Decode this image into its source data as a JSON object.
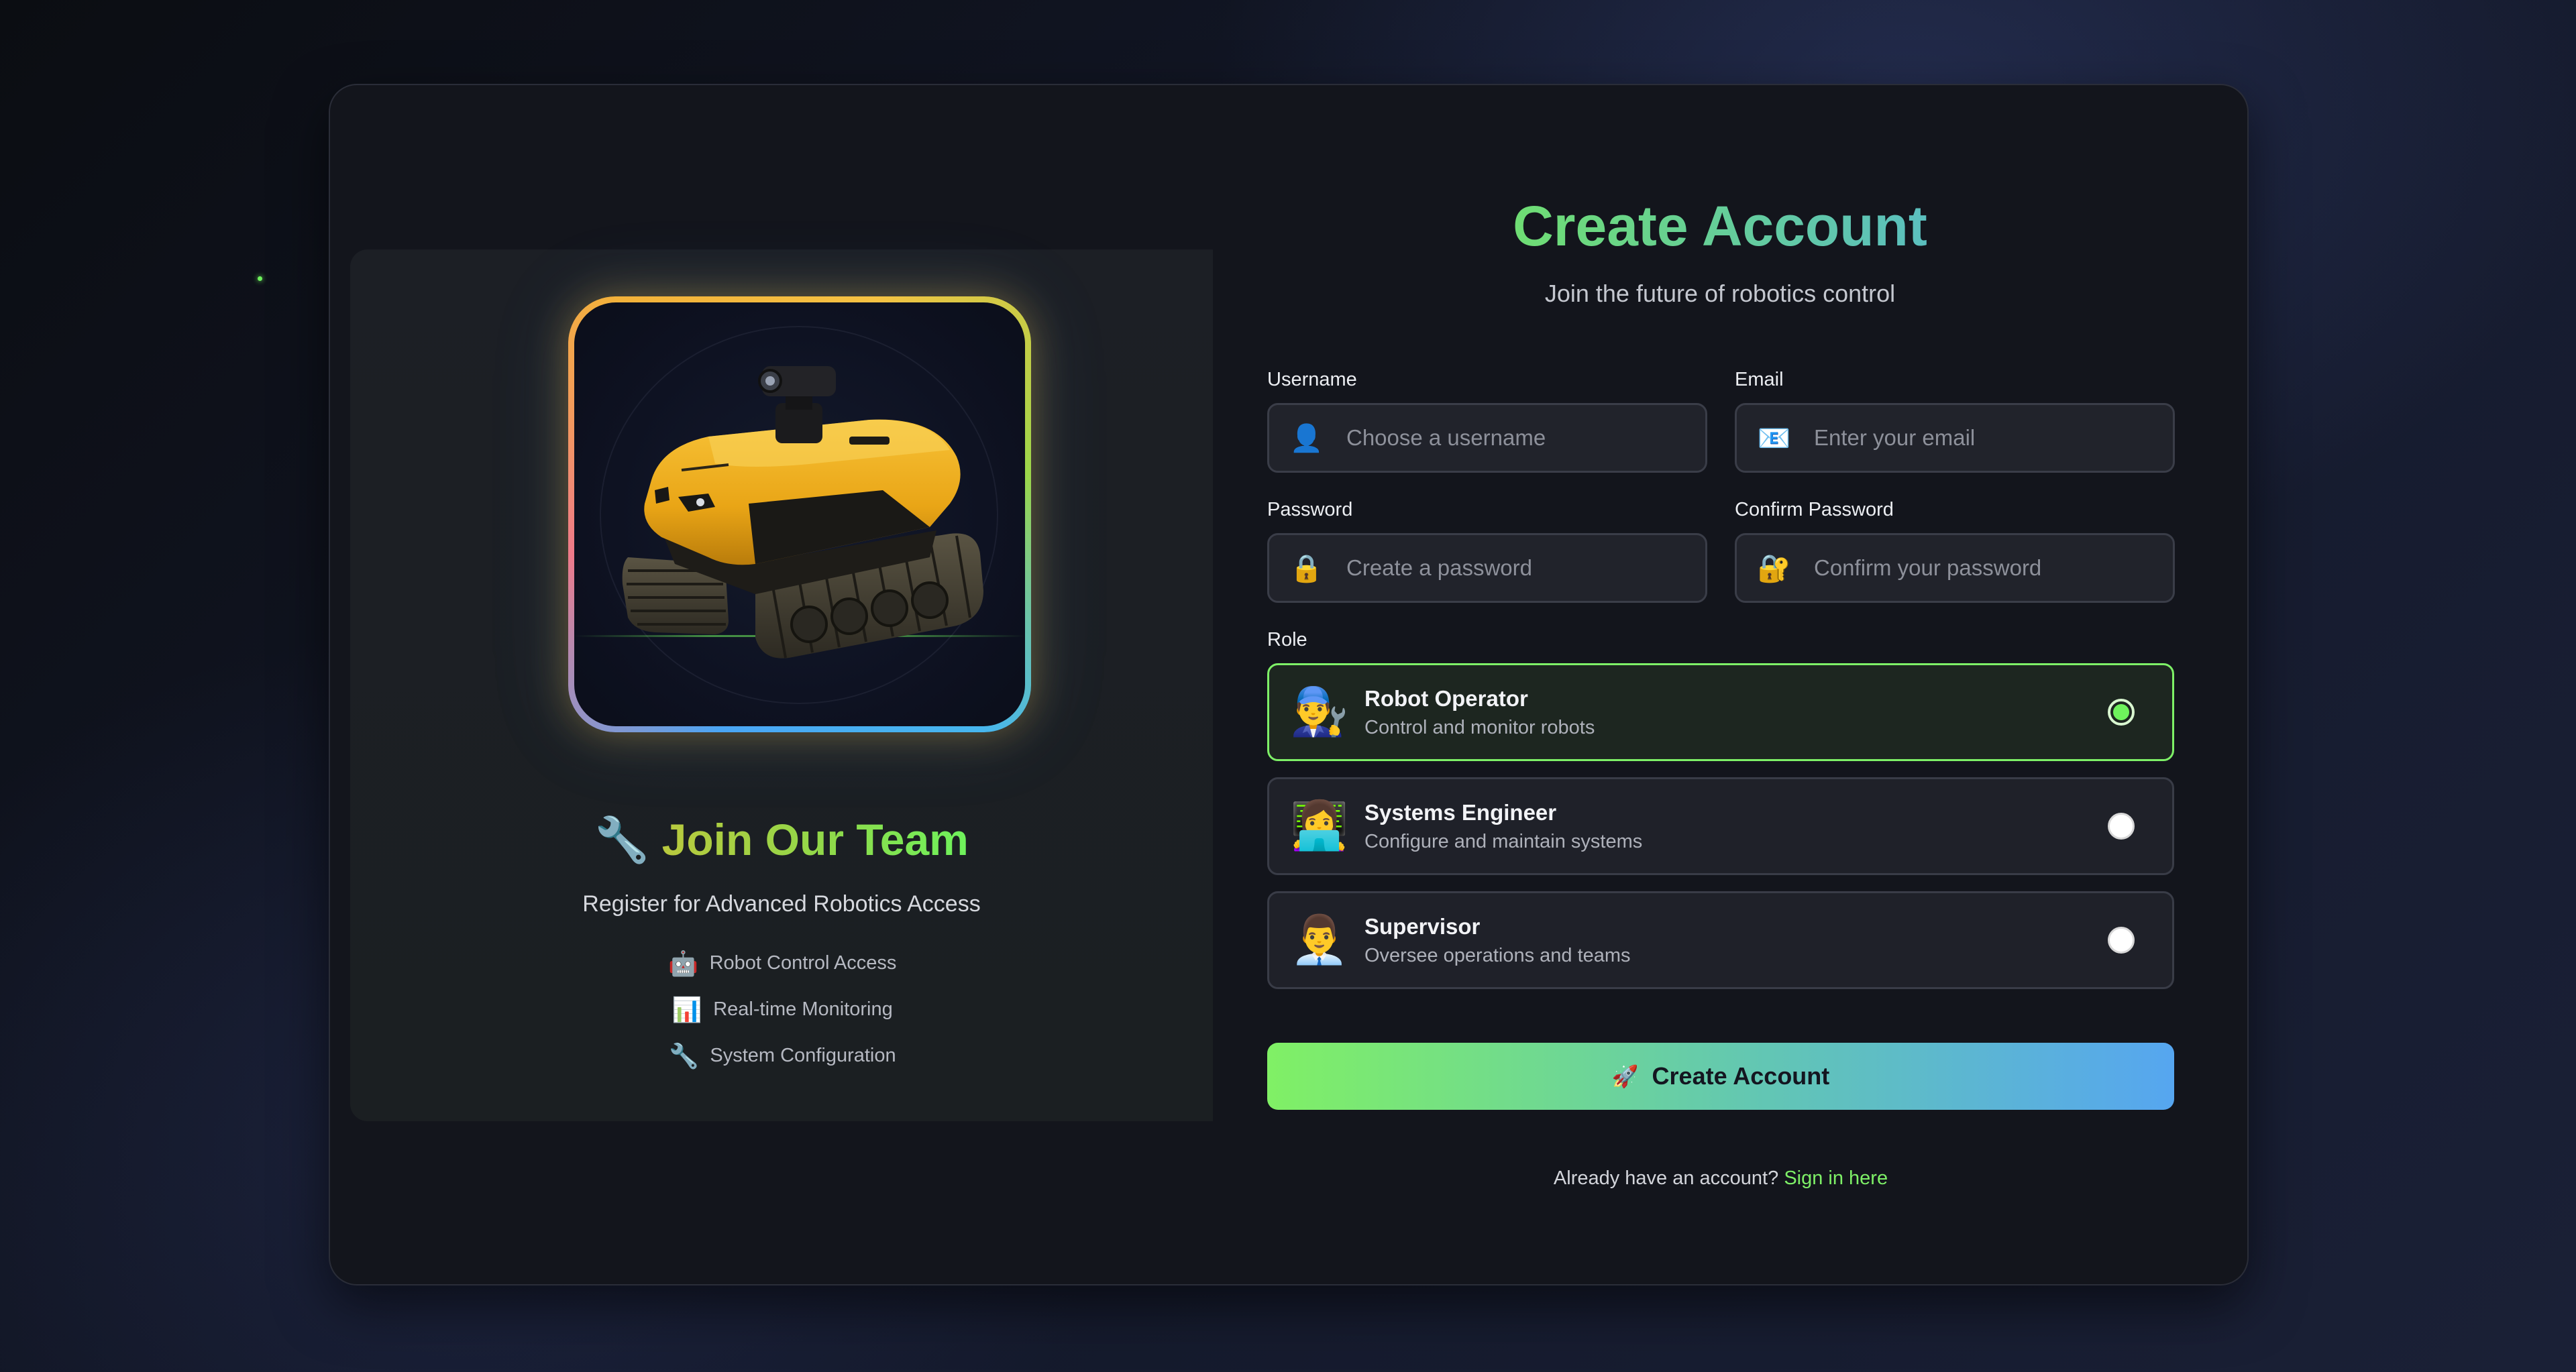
{
  "left_panel": {
    "robot_image_alt": "Yellow tracked robot",
    "join_icon": "🔧",
    "join_title": "Join Our Team",
    "join_subtitle": "Register for Advanced Robotics Access",
    "features": [
      {
        "icon": "🤖",
        "icon_name": "robot-icon",
        "label": "Robot Control Access"
      },
      {
        "icon": "📊",
        "icon_name": "bar-chart-icon",
        "label": "Real-time Monitoring"
      },
      {
        "icon": "🔧",
        "icon_name": "wrench-icon",
        "label": "System Configuration"
      }
    ]
  },
  "form": {
    "title": "Create Account",
    "subtitle": "Join the future of robotics control",
    "username": {
      "label": "Username",
      "placeholder": "Choose a username",
      "icon": "👤",
      "value": ""
    },
    "email": {
      "label": "Email",
      "placeholder": "Enter your email",
      "icon": "📧",
      "value": ""
    },
    "password": {
      "label": "Password",
      "placeholder": "Create a password",
      "icon": "🔒",
      "value": ""
    },
    "confirm_password": {
      "label": "Confirm Password",
      "placeholder": "Confirm your password",
      "icon": "🔐",
      "value": ""
    },
    "role_label": "Role",
    "roles": [
      {
        "icon": "👨‍🔧",
        "name": "Robot Operator",
        "description": "Control and monitor robots",
        "selected": true
      },
      {
        "icon": "👩‍💻",
        "name": "Systems Engineer",
        "description": "Configure and maintain systems",
        "selected": false
      },
      {
        "icon": "👨‍💼",
        "name": "Supervisor",
        "description": "Oversee operations and teams",
        "selected": false
      }
    ],
    "submit": {
      "icon": "🚀",
      "label": "Create Account"
    },
    "signin_prompt": "Already have an account?",
    "signin_link": "Sign in here"
  },
  "colors": {
    "accent_green": "#6ef25c",
    "accent_blue": "#56a6f0",
    "card_background": "#13151c",
    "input_background": "#21232b"
  }
}
